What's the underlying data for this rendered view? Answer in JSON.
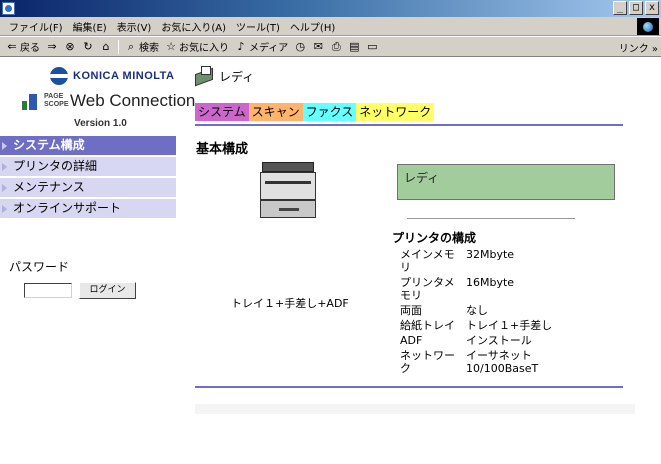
{
  "window": {
    "min_label": "_",
    "max_label": "□",
    "close_label": "x"
  },
  "menubar": {
    "items": [
      "ファイル(F)",
      "編集(E)",
      "表示(V)",
      "お気に入り(A)",
      "ツール(T)",
      "ヘルプ(H)"
    ]
  },
  "toolbar": {
    "back_label": "戻る",
    "search_label": "検索",
    "favorites_label": "お気に入り",
    "media_label": "メディア",
    "links_label": "リンク »"
  },
  "brand": {
    "konica": "KONICA MINOLTA",
    "pagescope_small": "PAGE SCOPE",
    "product": "Web Connection",
    "version": "Version 1.0"
  },
  "sidebar": {
    "items": [
      {
        "label": "システム構成"
      },
      {
        "label": "プリンタの詳細"
      },
      {
        "label": "メンテナンス"
      },
      {
        "label": "オンラインサポート"
      }
    ]
  },
  "login": {
    "password_label": "パスワード",
    "login_button": "ログイン"
  },
  "status": {
    "text": "レディ",
    "box_text": "レディ"
  },
  "tabs": [
    {
      "label": "システム",
      "color": "#cc66cc"
    },
    {
      "label": "スキャン",
      "color": "#ffb36b"
    },
    {
      "label": "ファクス",
      "color": "#66ffff"
    },
    {
      "label": "ネットワーク",
      "color": "#ffff66"
    }
  ],
  "main": {
    "section_title": "基本構成",
    "config_label": "トレイ１+手差し+ADF",
    "info_title": "プリンタの構成",
    "specs": [
      {
        "k": "メインメモリ",
        "v": "32Mbyte"
      },
      {
        "k": "プリンタメモリ",
        "v": "16Mbyte"
      },
      {
        "k": "両面",
        "v": "なし"
      },
      {
        "k": "給紙トレイ",
        "v": "トレイ１+手差し"
      },
      {
        "k": "ADF",
        "v": "インストール"
      },
      {
        "k": "ネットワーク",
        "v": "イーサネット 10/100BaseT"
      }
    ]
  }
}
